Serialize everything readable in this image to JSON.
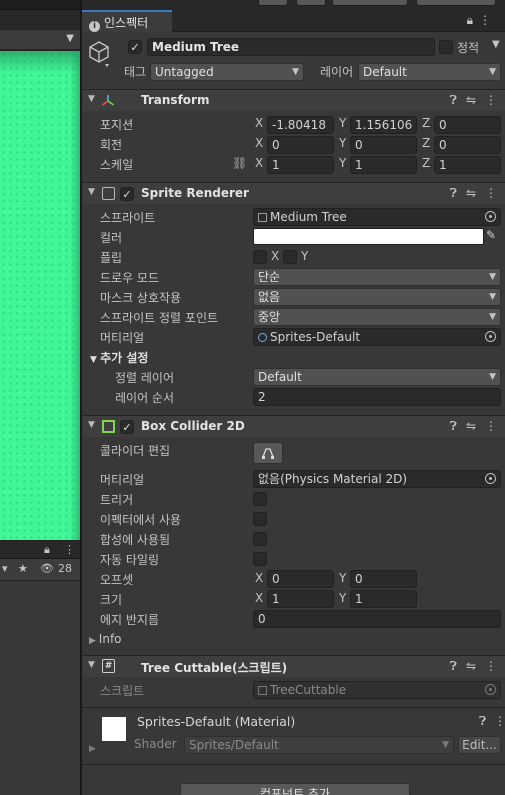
{
  "scene": {
    "counter": "28"
  },
  "inspector": {
    "tab_label": "인스펙터",
    "object": {
      "name": "Medium Tree",
      "static_label": "정적",
      "tag_label": "태그",
      "tag_value": "Untagged",
      "layer_label": "레이어",
      "layer_value": "Default"
    },
    "transform": {
      "title": "Transform",
      "position_label": "포지션",
      "rotation_label": "회전",
      "scale_label": "스케일",
      "position": {
        "x": "-1.80418",
        "y": "1.156106",
        "z": "0"
      },
      "rotation": {
        "x": "0",
        "y": "0",
        "z": "0"
      },
      "scale": {
        "x": "1",
        "y": "1",
        "z": "1"
      }
    },
    "sprite_renderer": {
      "title": "Sprite Renderer",
      "sprite_label": "스프라이트",
      "sprite_value": "Medium Tree",
      "color_label": "컬러",
      "color_value": "#ffffff",
      "flip_label": "플립",
      "flip_x": "X",
      "flip_y": "Y",
      "draw_mode_label": "드로우 모드",
      "draw_mode_value": "단순",
      "mask_label": "마스크 상호작용",
      "mask_value": "없음",
      "pivot_label": "스프라이트 정렬 포인트",
      "pivot_value": "중앙",
      "material_label": "머티리얼",
      "material_value": "Sprites-Default",
      "additional_label": "추가 설정",
      "sorting_layer_label": "정렬 레이어",
      "sorting_layer_value": "Default",
      "order_label": "레이어 순서",
      "order_value": "2"
    },
    "box_collider": {
      "title": "Box Collider 2D",
      "edit_label": "콜라이더 편집",
      "material_label": "머티리얼",
      "material_value": "없음(Physics Material 2D)",
      "trigger_label": "트리거",
      "effector_label": "이펙터에서 사용",
      "composite_label": "합성에 사용됨",
      "autotiling_label": "자동 타일링",
      "offset_label": "오프셋",
      "offset": {
        "x": "0",
        "y": "0"
      },
      "size_label": "크기",
      "size": {
        "x": "1",
        "y": "1"
      },
      "edge_label": "에지 반지름",
      "edge_value": "0",
      "info_label": "Info"
    },
    "script_component": {
      "title": "Tree Cuttable(스크립트)",
      "script_label": "스크립트",
      "script_value": "TreeCuttable"
    },
    "material": {
      "name": "Sprites-Default (Material)",
      "shader_label": "Shader",
      "shader_value": "Sprites/Default",
      "edit_label": "Edit..."
    },
    "add_component_label": "컴포넌트 추가"
  }
}
